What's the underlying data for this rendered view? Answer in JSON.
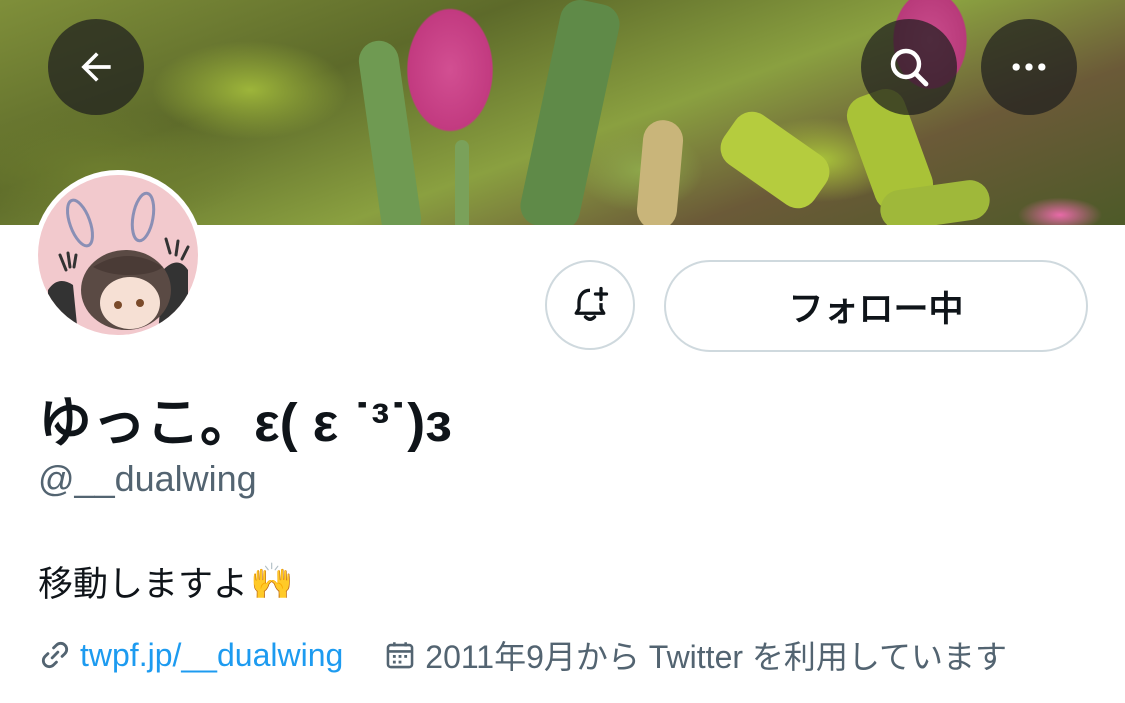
{
  "header": {
    "back_icon": "arrow-left-icon",
    "search_icon": "search-icon",
    "more_icon": "more-horizontal-icon"
  },
  "profile": {
    "display_name": "ゆっこ。ε( ε ˙³˙)з",
    "handle": "@__dualwing",
    "bio": "移動しますよ",
    "bio_emoji": "🙌",
    "website": "twpf.jp/__dualwing",
    "joined": "2011年9月から Twitter を利用しています"
  },
  "actions": {
    "follow_label": "フォロー中",
    "notify_icon": "bell-plus-icon"
  },
  "colors": {
    "accent": "#1d9bf0",
    "secondary_text": "#536471",
    "border": "#cfd9de"
  }
}
